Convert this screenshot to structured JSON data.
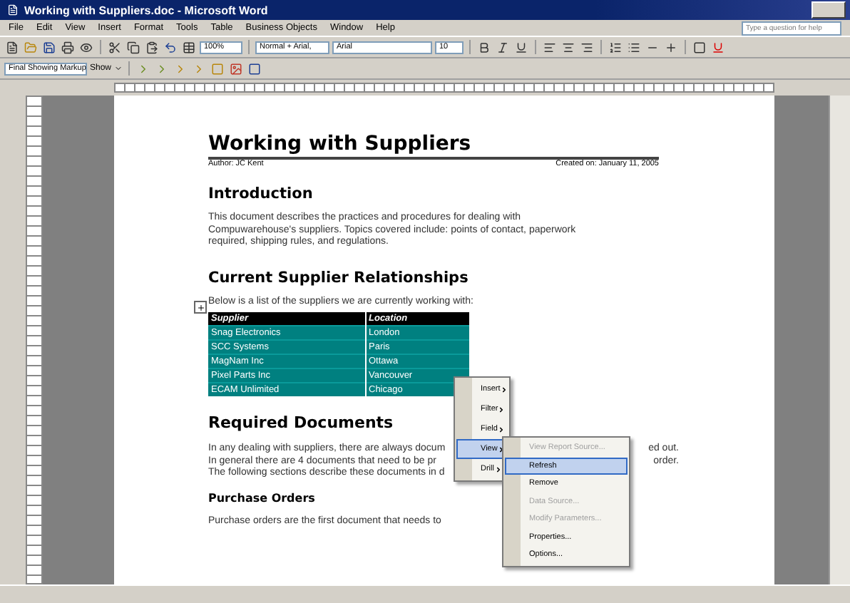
{
  "window": {
    "title": "Working with Suppliers.doc - Microsoft Word"
  },
  "menu_bar": {
    "items": [
      "File",
      "Edit",
      "View",
      "Insert",
      "Format",
      "Tools",
      "Table",
      "Business Objects",
      "Window",
      "Help"
    ]
  },
  "help_box": {
    "placeholder": "Type a question for help"
  },
  "formatting_toolbar": {
    "zoom": "100%",
    "style": "Normal + Arial,",
    "font": "Arial",
    "size": "10"
  },
  "reviewing_toolbar": {
    "display": "Final Showing Markup",
    "show": "Show"
  },
  "document": {
    "title": "Working with Suppliers",
    "author": "Author: JC Kent",
    "created": "Created on: January 11, 2005",
    "introduction": {
      "heading": "Introduction",
      "lines": [
        "This document describes the practices and procedures for dealing with",
        "Compuwarehouse's suppliers. Topics covered include: points of contact, paperwork",
        "required, shipping rules, and regulations."
      ]
    },
    "relationships": {
      "heading": "Current Supplier Relationships",
      "intro": "Below is a list of the suppliers we are currently working with:"
    },
    "table": {
      "columns": [
        "Supplier",
        "Location"
      ],
      "rows": [
        {
          "supplier": "Snag Electronics",
          "location": "London"
        },
        {
          "supplier": "SCC Systems",
          "location": "Paris"
        },
        {
          "supplier": "MagNam Inc",
          "location": "Ottawa"
        },
        {
          "supplier": "Pixel Parts Inc",
          "location": "Vancouver"
        },
        {
          "supplier": "ECAM Unlimited",
          "location": "Chicago"
        }
      ]
    },
    "required": {
      "heading": "Required Documents",
      "lines": [
        {
          "left": "In any dealing with suppliers, there are always docum",
          "right": "ed out."
        },
        {
          "left": "In general there are 4 documents that need to be pr",
          "right": "order."
        },
        {
          "left": "The following sections describe these documents in d"
        }
      ]
    },
    "purchase": {
      "heading": "Purchase Orders",
      "line": "Purchase orders are the first document that needs to"
    }
  },
  "context_menu": {
    "items": [
      {
        "label": "Insert",
        "selected": false
      },
      {
        "label": "Filter",
        "selected": false
      },
      {
        "label": "Field",
        "selected": false
      },
      {
        "label": "View",
        "selected": true
      },
      {
        "label": "Drill",
        "selected": false
      }
    ]
  },
  "submenu": {
    "items": [
      {
        "label": "View Report Source...",
        "disabled": true,
        "selected": false
      },
      {
        "label": "Refresh",
        "disabled": false,
        "selected": true
      },
      {
        "label": "Remove",
        "disabled": false,
        "selected": false
      },
      {
        "label": "Data Source...",
        "disabled": true,
        "selected": false
      },
      {
        "label": "Modify Parameters...",
        "disabled": true,
        "selected": false
      },
      {
        "label": "Properties...",
        "disabled": false,
        "selected": false
      },
      {
        "label": "Options...",
        "disabled": false,
        "selected": false
      }
    ]
  }
}
